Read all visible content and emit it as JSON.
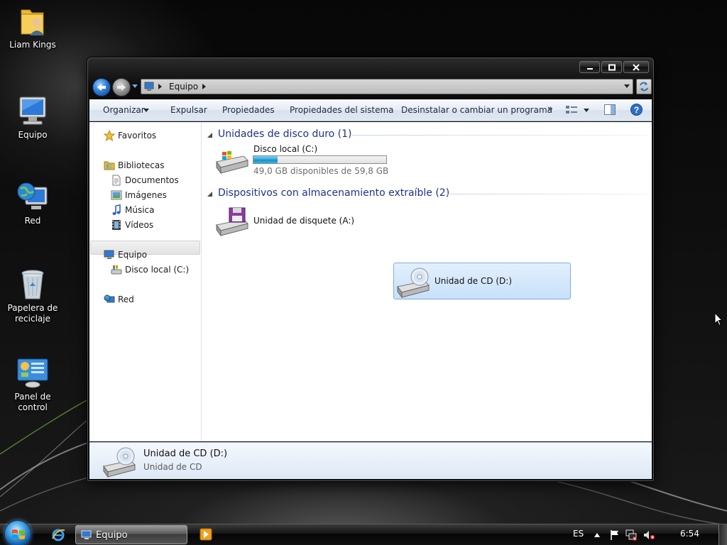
{
  "desktop": {
    "icons": [
      {
        "label": "Liam Kings",
        "icon": "user-folder-icon"
      },
      {
        "label": "Equipo",
        "icon": "computer-icon"
      },
      {
        "label": "Red",
        "icon": "network-icon"
      },
      {
        "label": "Papelera de reciclaje",
        "icon": "recycle-bin-icon"
      },
      {
        "label": "Panel de control",
        "icon": "control-panel-icon"
      }
    ]
  },
  "window": {
    "address": {
      "crumb": "Equipo"
    },
    "toolbar": {
      "organize": "Organizar",
      "eject": "Expulsar",
      "properties": "Propiedades",
      "system_properties": "Propiedades del sistema",
      "uninstall": "Desinstalar o cambiar un programa",
      "more": "»"
    },
    "navpane": {
      "favorites": "Favoritos",
      "libraries": "Bibliotecas",
      "documents": "Documentos",
      "images": "Imágenes",
      "music": "Música",
      "videos": "Vídeos",
      "computer": "Equipo",
      "local_disk": "Disco local (C:)",
      "network": "Red"
    },
    "groups": {
      "hard_disks": "Unidades de disco duro (1)",
      "removable": "Dispositivos con almacenamiento extraíble (2)"
    },
    "drives": {
      "c": {
        "name": "Disco local (C:)",
        "free_text": "49,0 GB disponibles de 59,8 GB",
        "used_fraction": 0.18
      },
      "a": {
        "name": "Unidad de disquete (A:)"
      },
      "d": {
        "name": "Unidad de CD (D:)"
      }
    },
    "details": {
      "name": "Unidad de CD (D:)",
      "type": "Unidad de CD"
    }
  },
  "taskbar": {
    "window_button": "Equipo",
    "language": "ES",
    "clock": "6:54"
  },
  "colors": {
    "group_header": "#1e3287",
    "selection_border": "#84acdd",
    "capacity_fill": "#2ea6d8"
  }
}
